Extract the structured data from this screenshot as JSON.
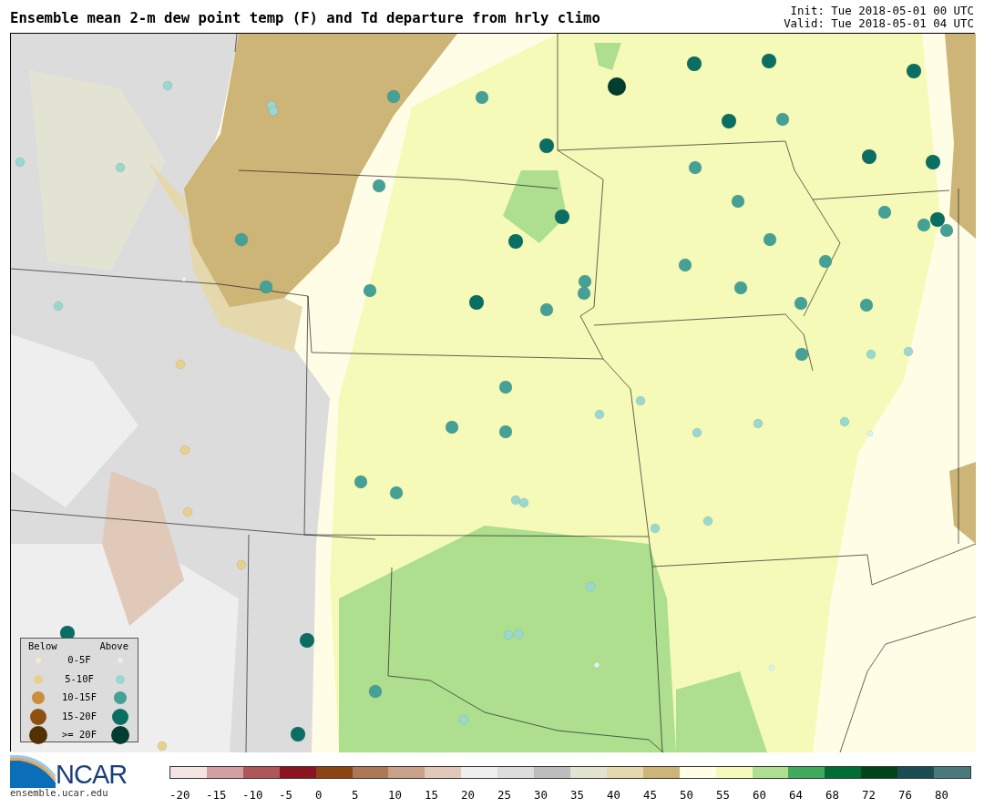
{
  "title": "Ensemble mean 2-m dew point temp (F) and Td departure from hrly climo",
  "init": "Init: Tue 2018-05-01 00 UTC",
  "valid": "Valid: Tue 2018-05-01 04 UTC",
  "legend": {
    "below_heading": "Below",
    "above_heading": "Above",
    "rows": [
      {
        "label": "0-5F",
        "below": {
          "color": "#f6ebc8"
        },
        "above": {
          "color": "#dff2ef"
        }
      },
      {
        "label": "5-10F",
        "below": {
          "color": "#e8cf8c"
        },
        "above": {
          "color": "#98d8cf"
        }
      },
      {
        "label": "10-15F",
        "below": {
          "color": "#c98f3d"
        },
        "above": {
          "color": "#45a096"
        }
      },
      {
        "label": "15-20F",
        "below": {
          "color": "#8c5010"
        },
        "above": {
          "color": "#0b6e63"
        }
      },
      {
        "label": ">= 20F",
        "below": {
          "color": "#543005"
        },
        "above": {
          "color": "#023d2f"
        }
      }
    ]
  },
  "logo": {
    "name": "NCAR",
    "url": "ensemble.ucar.edu"
  },
  "colorbar": {
    "cells": [
      {
        "color": "#f3e4e3"
      },
      {
        "color": "#d3a0a2"
      },
      {
        "color": "#ae5658"
      },
      {
        "color": "#8a141f"
      },
      {
        "color": "#8a4512"
      },
      {
        "color": "#ad7856"
      },
      {
        "color": "#c8a188"
      },
      {
        "color": "#e1c9ba"
      },
      {
        "color": "#eeeeee"
      },
      {
        "color": "#dcdcdc"
      },
      {
        "color": "#bdbdbd"
      },
      {
        "color": "#e3e3d3"
      },
      {
        "color": "#e5d8ac"
      },
      {
        "color": "#cdb477"
      },
      {
        "color": "#fffde6"
      },
      {
        "color": "#f6fab9"
      },
      {
        "color": "#addf8f"
      },
      {
        "color": "#41ab5d"
      },
      {
        "color": "#006d35"
      },
      {
        "color": "#00441c"
      },
      {
        "color": "#1a4d52"
      },
      {
        "color": "#4b7a7a"
      }
    ],
    "ticks": [
      "-20",
      "-15",
      "-10",
      "-5",
      "0",
      "5",
      "10",
      "15",
      "20",
      "25",
      "30",
      "35",
      "40",
      "45",
      "50",
      "55",
      "60",
      "64",
      "68",
      "72",
      "76",
      "80"
    ]
  }
}
